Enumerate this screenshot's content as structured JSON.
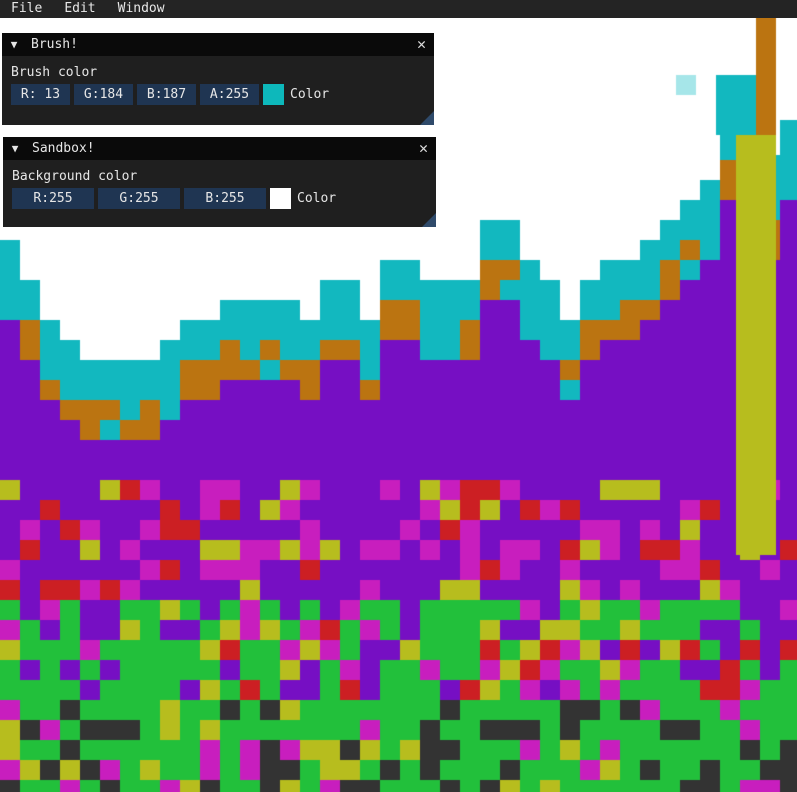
{
  "menubar": {
    "file": "File",
    "edit": "Edit",
    "window": "Window"
  },
  "brush_panel": {
    "title": "Brush!",
    "label": "Brush color",
    "r": "R: 13",
    "g": "G:184",
    "b": "B:187",
    "a": "A:255",
    "swatch_color": "#0db8bb",
    "color_label": "Color"
  },
  "sandbox_panel": {
    "title": "Sandbox!",
    "label": "Background color",
    "r": "R:255",
    "g": "G:255",
    "b": "B:255",
    "swatch_color": "#ffffff",
    "color_label": "Color"
  },
  "palette": {
    "background": "#ffffff",
    "teal": "#12b8bf",
    "orange": "#bb7411",
    "purple": "#760fc3",
    "magenta": "#c81ebe",
    "red": "#cc1f23",
    "yellow": "#b7bd1e",
    "green": "#22c03b",
    "dark": "#333333"
  }
}
